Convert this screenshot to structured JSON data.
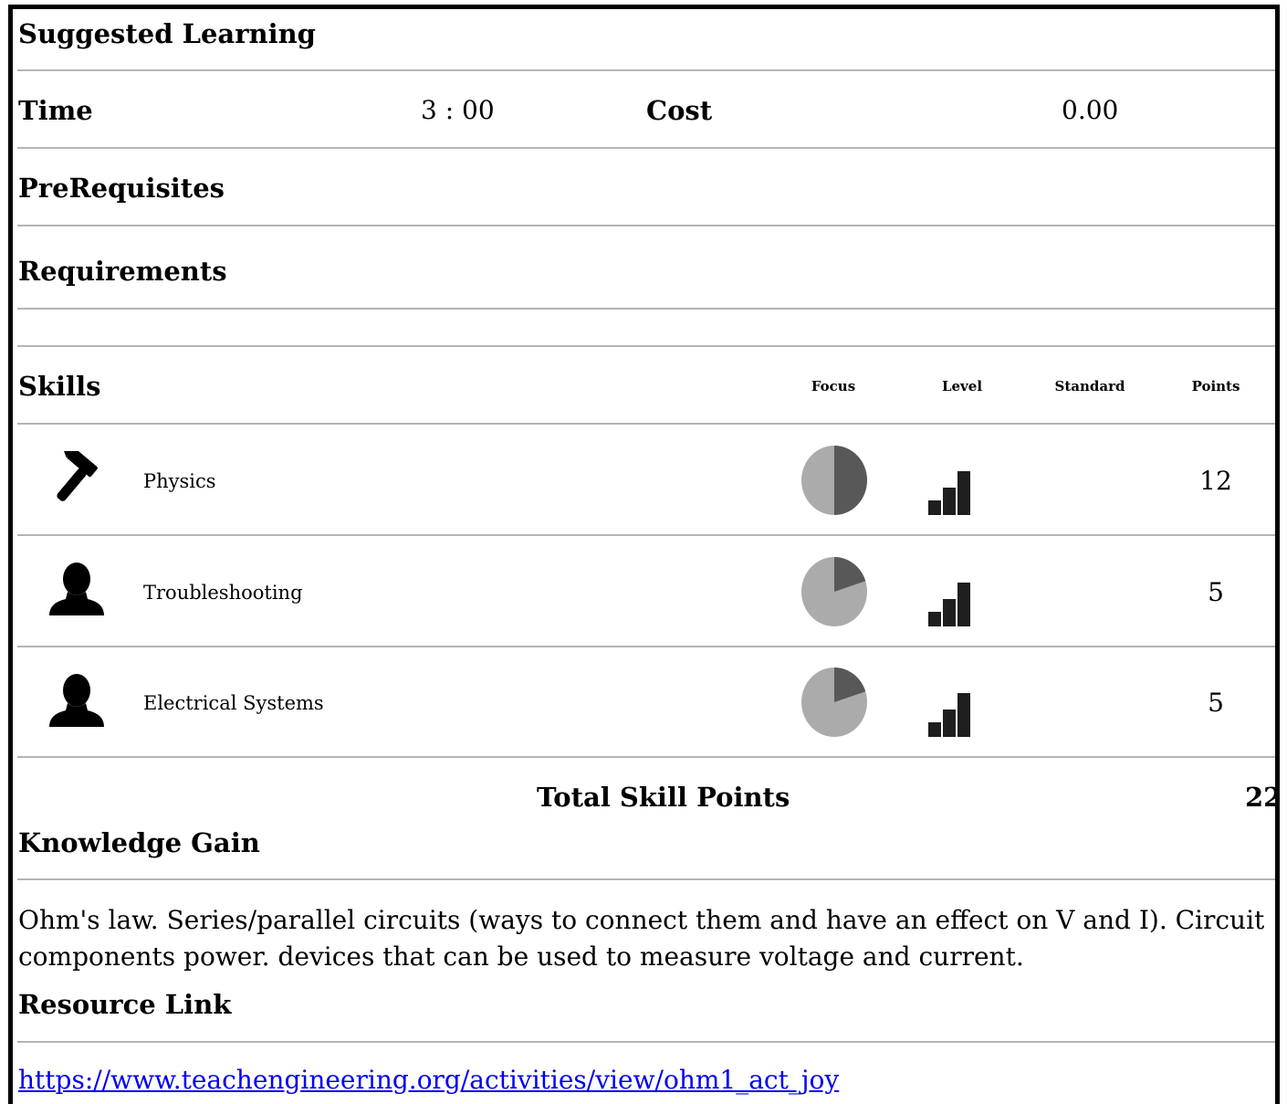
{
  "title": "Suggested Learning",
  "time": {
    "label": "Time",
    "value": "3 : 00"
  },
  "cost": {
    "label": "Cost",
    "value": "0.00"
  },
  "prerequisites": {
    "label": "PreRequisites"
  },
  "requirements": {
    "label": "Requirements"
  },
  "skills": {
    "label": "Skills",
    "columns": {
      "focus": "Focus",
      "level": "Level",
      "standard": "Standard",
      "points": "Points"
    },
    "rows": [
      {
        "icon": "hammer-icon",
        "name": "Physics",
        "focus_fraction": 0.5,
        "level": 3,
        "points": "12"
      },
      {
        "icon": "person-icon",
        "name": "Troubleshooting",
        "focus_fraction": 0.2,
        "level": 3,
        "points": "5"
      },
      {
        "icon": "person-icon",
        "name": "Electrical Systems",
        "focus_fraction": 0.2,
        "level": 3,
        "points": "5"
      }
    ],
    "total_label": "Total Skill Points",
    "total_value": "22"
  },
  "knowledge": {
    "label": "Knowledge Gain",
    "text_line1": "Ohm's law. Series/parallel circuits (ways to connect them and have an effect on V and I). Circuit",
    "text_line2": "components power. devices that can be used to measure voltage and current."
  },
  "resource": {
    "label": "Resource Link",
    "url": "https://www.teachengineering.org/activities/view/ohm1_act_joy"
  },
  "colors": {
    "pie_light": "#ababab",
    "pie_dark": "#585858",
    "bars": "#1e1e1e",
    "rule": "#b4b4b4"
  }
}
